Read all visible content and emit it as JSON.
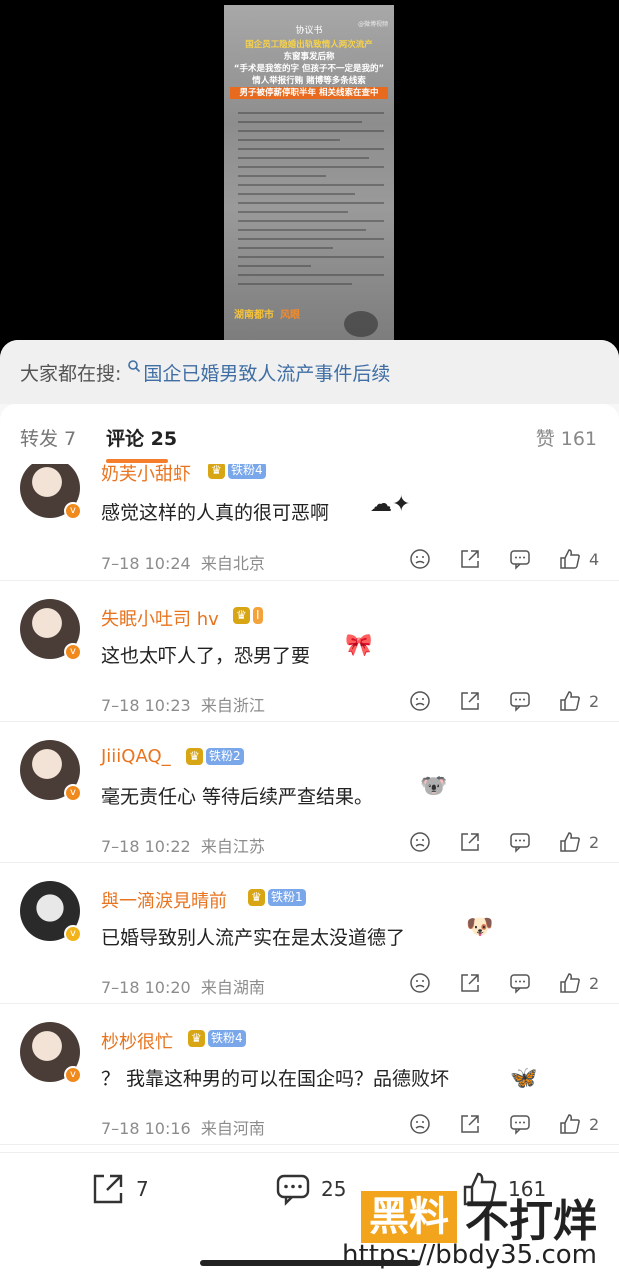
{
  "video": {
    "doc_title": "协议书",
    "watermark": "@微博视频",
    "headlines": [
      "国企员工隐婚出轨致情人两次流产",
      "东窗事发后称",
      "“手术是我签的字 但孩子不一定是我的”",
      "情人举报行贿 赌博等多条线索",
      "男子被停薪停职半年 相关线索在查中"
    ],
    "logo_left": "湖南都市",
    "logo_right": "风眼"
  },
  "search": {
    "prefix": "大家都在搜:",
    "term": "国企已婚男致人流产事件后续"
  },
  "tabs": {
    "repost": "转发 7",
    "comment": "评论 25",
    "like": "赞 161"
  },
  "comments": [
    {
      "user": "奶芙小甜虾",
      "crown": "♛",
      "fan": "铁粉4",
      "text": "感觉这样的人真的很可恶啊",
      "sticker": "☁✦",
      "time": "7–18 10:24",
      "loc": "来自北京",
      "likes": "4"
    },
    {
      "user": "失眠小吐司 hv",
      "crown": "♛",
      "fan": "I",
      "text": "这也太吓人了，恐男了要",
      "sticker": "🎀",
      "time": "7–18 10:23",
      "loc": "来自浙江",
      "likes": "2"
    },
    {
      "user": "JiiiQAQ_",
      "crown": "♛",
      "fan": "铁粉2",
      "text": "毫无责任心 等待后续严查结果。",
      "sticker": "🐨",
      "time": "7–18 10:22",
      "loc": "来自江苏",
      "likes": "2"
    },
    {
      "user": "與一滴淚見晴前",
      "crown": "♛",
      "fan": "铁粉1",
      "text": "已婚导致别人流产实在是太没道德了",
      "sticker": "🐶",
      "time": "7–18 10:20",
      "loc": "来自湖南",
      "likes": "2"
    },
    {
      "user": "杪杪很忙",
      "crown": "♛",
      "fan": "铁粉4",
      "text": "？ 我靠这种男的可以在国企吗？品德败坏",
      "sticker": "🦋",
      "time": "7–18 10:16",
      "loc": "来自河南",
      "likes": "2"
    }
  ],
  "bottom": {
    "repost_count": "7",
    "comment_count": "25",
    "like_count": "161"
  },
  "watermark": {
    "box": "黑料",
    "text": "不打烊",
    "url": "https://bbdy35.com"
  }
}
